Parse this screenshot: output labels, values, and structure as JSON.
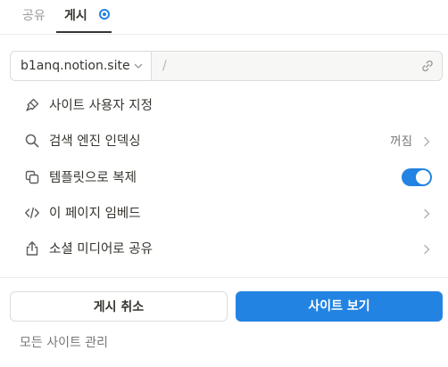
{
  "tabs": [
    {
      "label": "공유"
    },
    {
      "label": "게시"
    }
  ],
  "url": {
    "domain": "b1anq.notion.site",
    "separator": "/"
  },
  "options": [
    {
      "label": "사이트 사용자 지정",
      "icon": "paintbrush-icon"
    },
    {
      "label": "검색 엔진 인덱싱",
      "icon": "search-icon",
      "value": "꺼짐"
    },
    {
      "label": "템플릿으로 복제",
      "icon": "duplicate-icon",
      "toggle_on": true
    },
    {
      "label": "이 페이지 임베드",
      "icon": "code-icon"
    },
    {
      "label": "소셜 미디어로 공유",
      "icon": "share-icon"
    }
  ],
  "buttons": {
    "unpublish": "게시 취소",
    "view_site": "사이트 보기"
  },
  "footer": {
    "manage_sites": "모든 사이트 관리"
  },
  "colors": {
    "accent": "#2383e2",
    "text": "#37352f",
    "muted": "#787774"
  }
}
